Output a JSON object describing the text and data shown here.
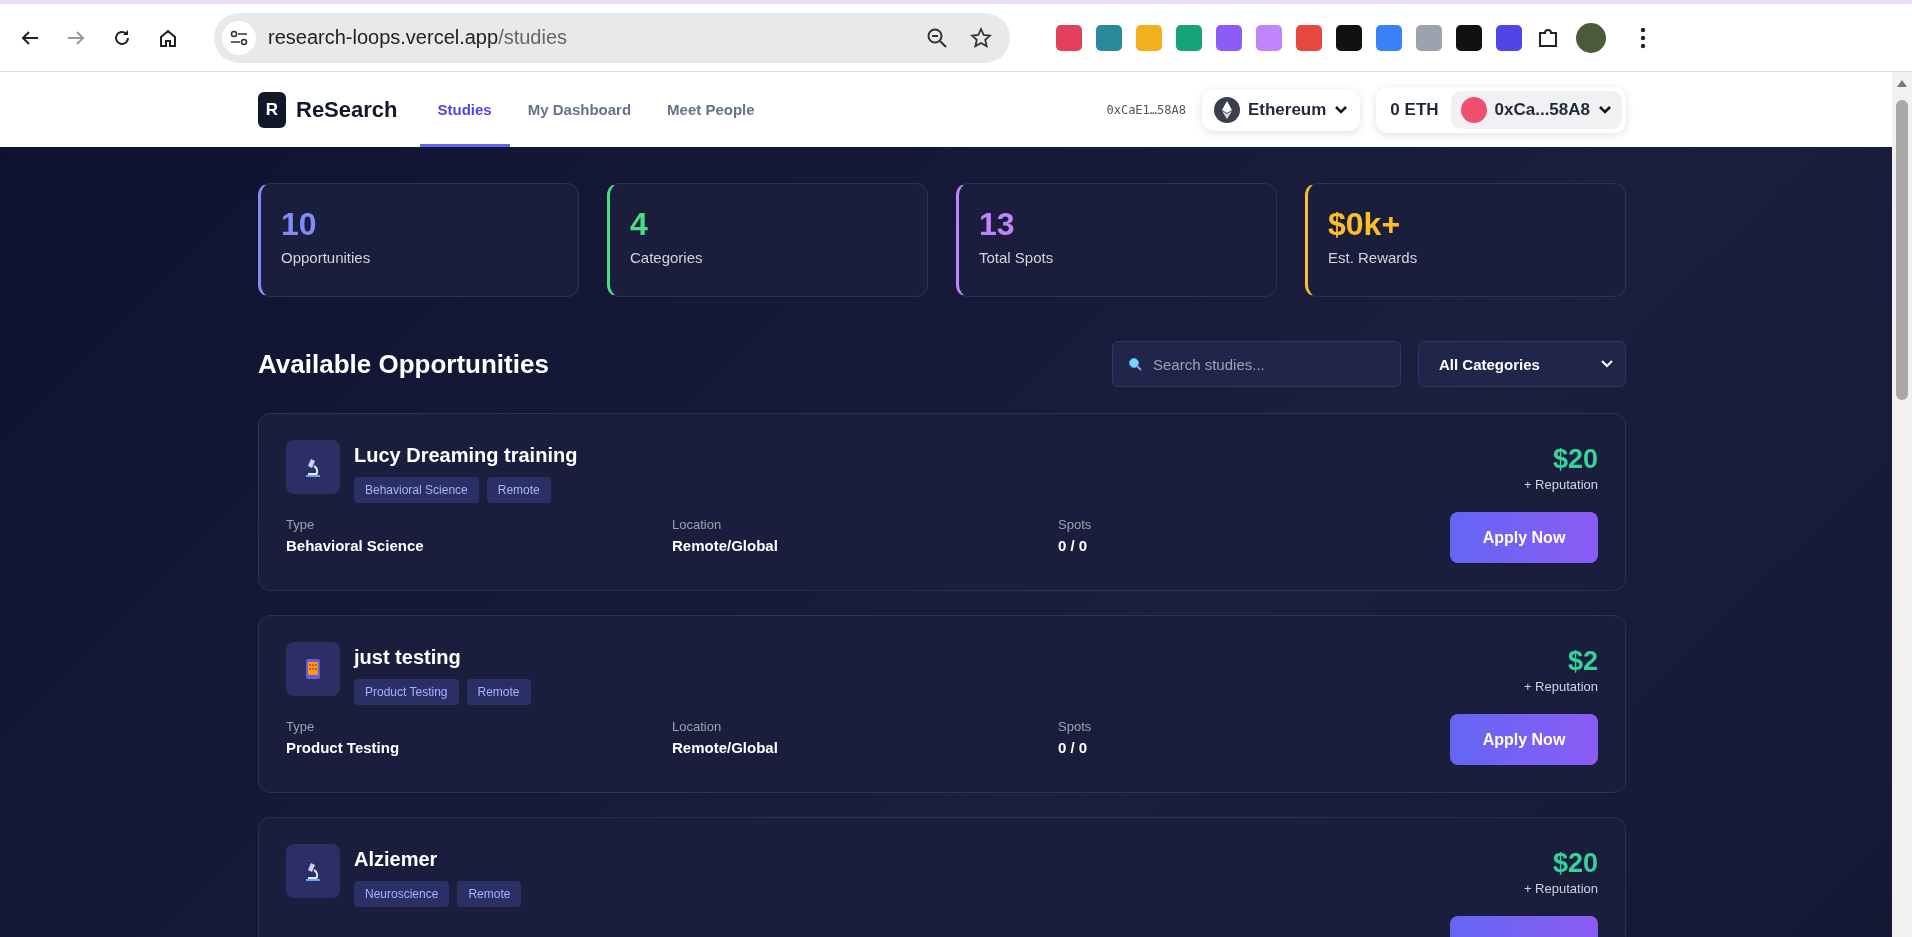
{
  "browser": {
    "url_host": "research-loops.vercel.app",
    "url_path": "/studies"
  },
  "header": {
    "logo_letter": "R",
    "brand": "ReSearch",
    "nav": [
      {
        "label": "Studies",
        "selected": true
      },
      {
        "label": "My Dashboard",
        "selected": false
      },
      {
        "label": "Meet People",
        "selected": false
      }
    ],
    "address": "0xCaE1…58A8",
    "network": "Ethereum",
    "balance": "0 ETH",
    "account": "0xCa...58A8"
  },
  "stats": [
    {
      "value": "10",
      "label": "Opportunities",
      "color": "#818cf8"
    },
    {
      "value": "4",
      "label": "Categories",
      "color": "#4ade80"
    },
    {
      "value": "13",
      "label": "Total Spots",
      "color": "#c084fc"
    },
    {
      "value": "$0k+",
      "label": "Est. Rewards",
      "color": "#fbbf24"
    }
  ],
  "section": {
    "title": "Available Opportunities",
    "search": {
      "placeholder": "Search studies..."
    },
    "category_filter": "All Categories"
  },
  "studies": [
    {
      "kind": "microscope",
      "title": "Lucy Dreaming training",
      "tags": [
        "Behavioral Science",
        "Remote"
      ],
      "reward": "$20",
      "bonus": "+ Reputation",
      "meta": [
        {
          "label": "Type",
          "value": "Behavioral Science"
        },
        {
          "label": "Location",
          "value": "Remote/Global"
        },
        {
          "label": "Spots",
          "value": "0 / 0"
        }
      ],
      "action": "Apply Now"
    },
    {
      "kind": "phone",
      "title": "just testing",
      "tags": [
        "Product Testing",
        "Remote"
      ],
      "reward": "$2",
      "bonus": "+ Reputation",
      "meta": [
        {
          "label": "Type",
          "value": "Product Testing"
        },
        {
          "label": "Location",
          "value": "Remote/Global"
        },
        {
          "label": "Spots",
          "value": "0 / 0"
        }
      ],
      "action": "Apply Now"
    },
    {
      "kind": "microscope",
      "title": "Alziemer",
      "tags": [
        "Neuroscience",
        "Remote"
      ],
      "reward": "$20",
      "bonus": "+ Reputation"
    }
  ]
}
